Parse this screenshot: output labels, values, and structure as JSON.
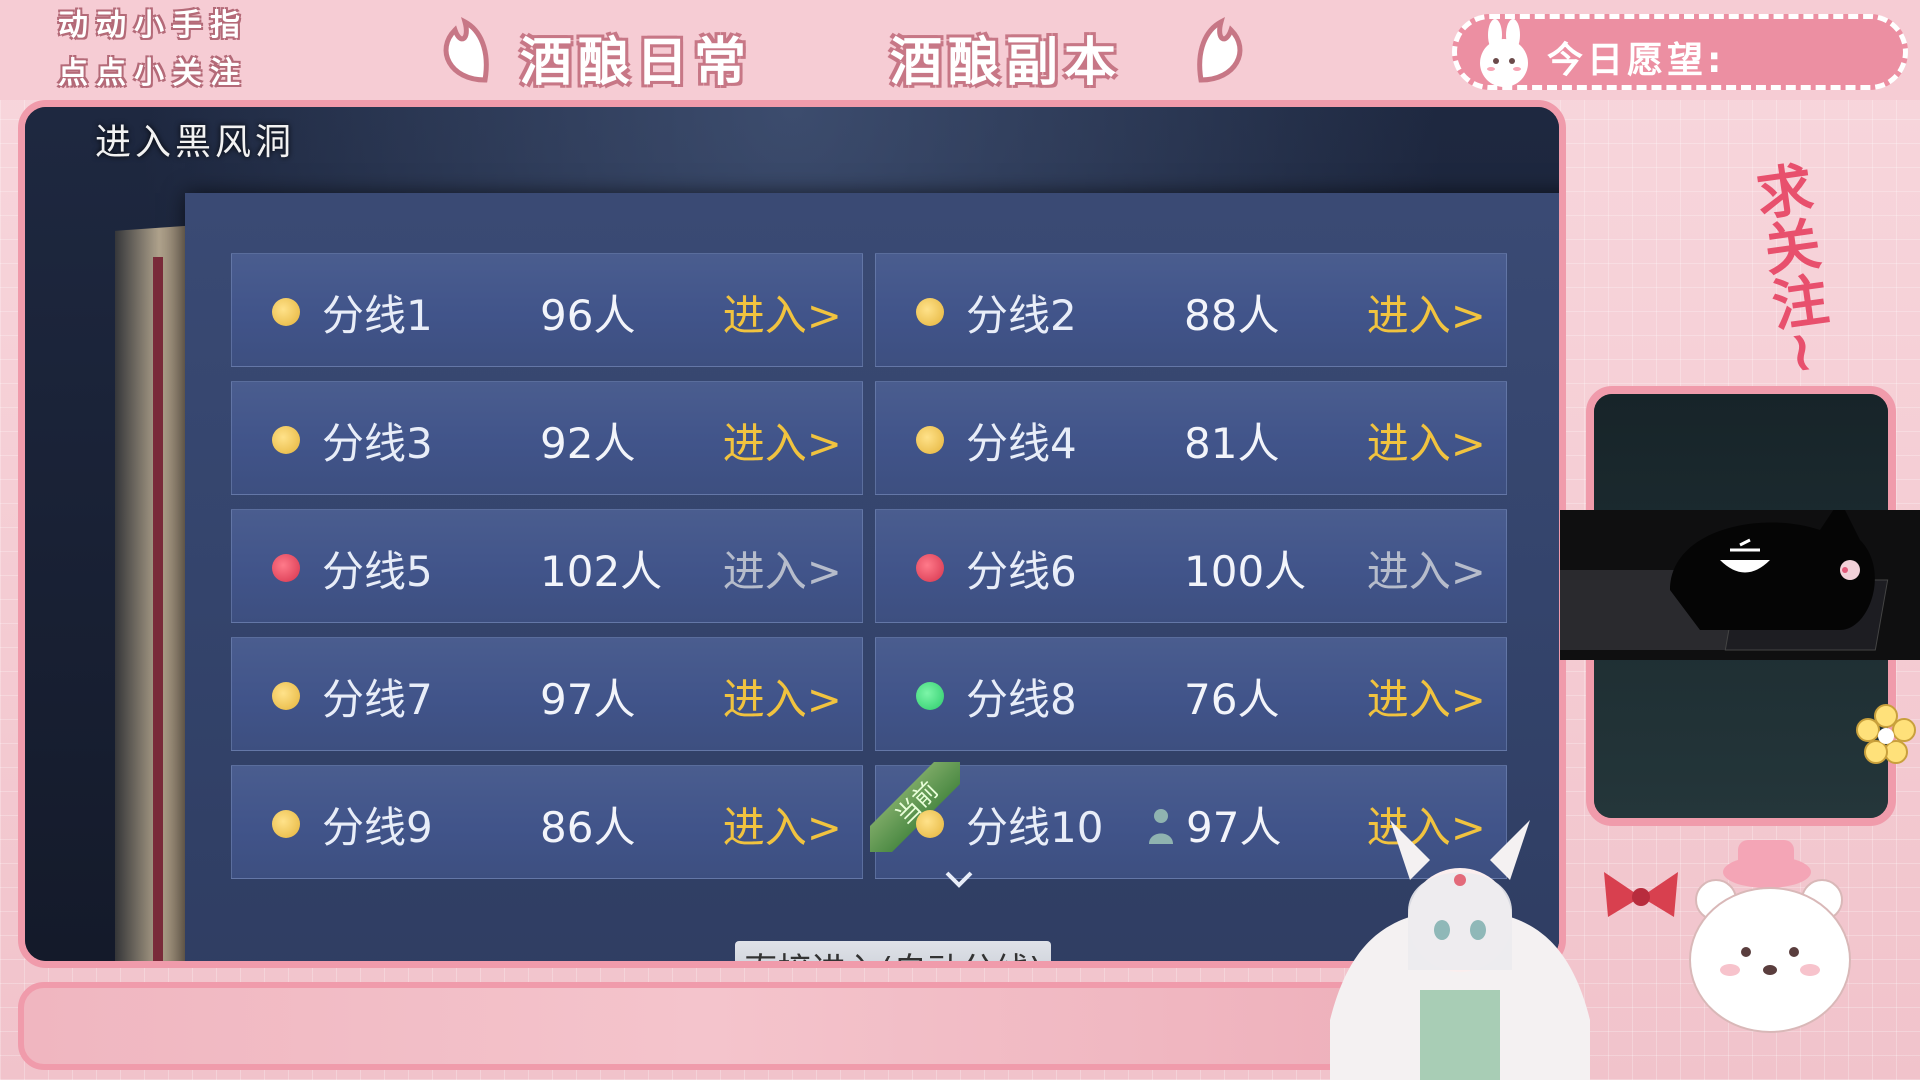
{
  "overlay": {
    "tip_line1": "动动小手指",
    "tip_line2": "点点小关注",
    "title_left": "酒酿日常",
    "title_right": "酒酿副本",
    "wish_label": "今日愿望:",
    "side_text": "求关注~"
  },
  "dialog": {
    "title": "进入黑风洞",
    "auto_enter_label": "直接进入(自动分线)"
  },
  "lines": [
    {
      "name": "分线1",
      "count": "96人",
      "status": "yellow",
      "enter": "进入>"
    },
    {
      "name": "分线2",
      "count": "88人",
      "status": "yellow",
      "enter": "进入>"
    },
    {
      "name": "分线3",
      "count": "92人",
      "status": "yellow",
      "enter": "进入>"
    },
    {
      "name": "分线4",
      "count": "81人",
      "status": "yellow",
      "enter": "进入>"
    },
    {
      "name": "分线5",
      "count": "102人",
      "status": "red",
      "enter": "进入>"
    },
    {
      "name": "分线6",
      "count": "100人",
      "status": "red",
      "enter": "进入>"
    },
    {
      "name": "分线7",
      "count": "97人",
      "status": "yellow",
      "enter": "进入>"
    },
    {
      "name": "分线8",
      "count": "76人",
      "status": "green",
      "enter": "进入>"
    },
    {
      "name": "分线9",
      "count": "86人",
      "status": "yellow",
      "enter": "进入>"
    },
    {
      "name": "分线10",
      "count": "97人",
      "status": "yellow",
      "enter": "进入>",
      "current_tag": "当前"
    }
  ],
  "colors": {
    "accent_pink": "#f09bab",
    "enter_gold": "#f1c33f",
    "status_yellow": "#e4b33b",
    "status_red": "#d5334c",
    "status_green": "#2ccb6b"
  }
}
